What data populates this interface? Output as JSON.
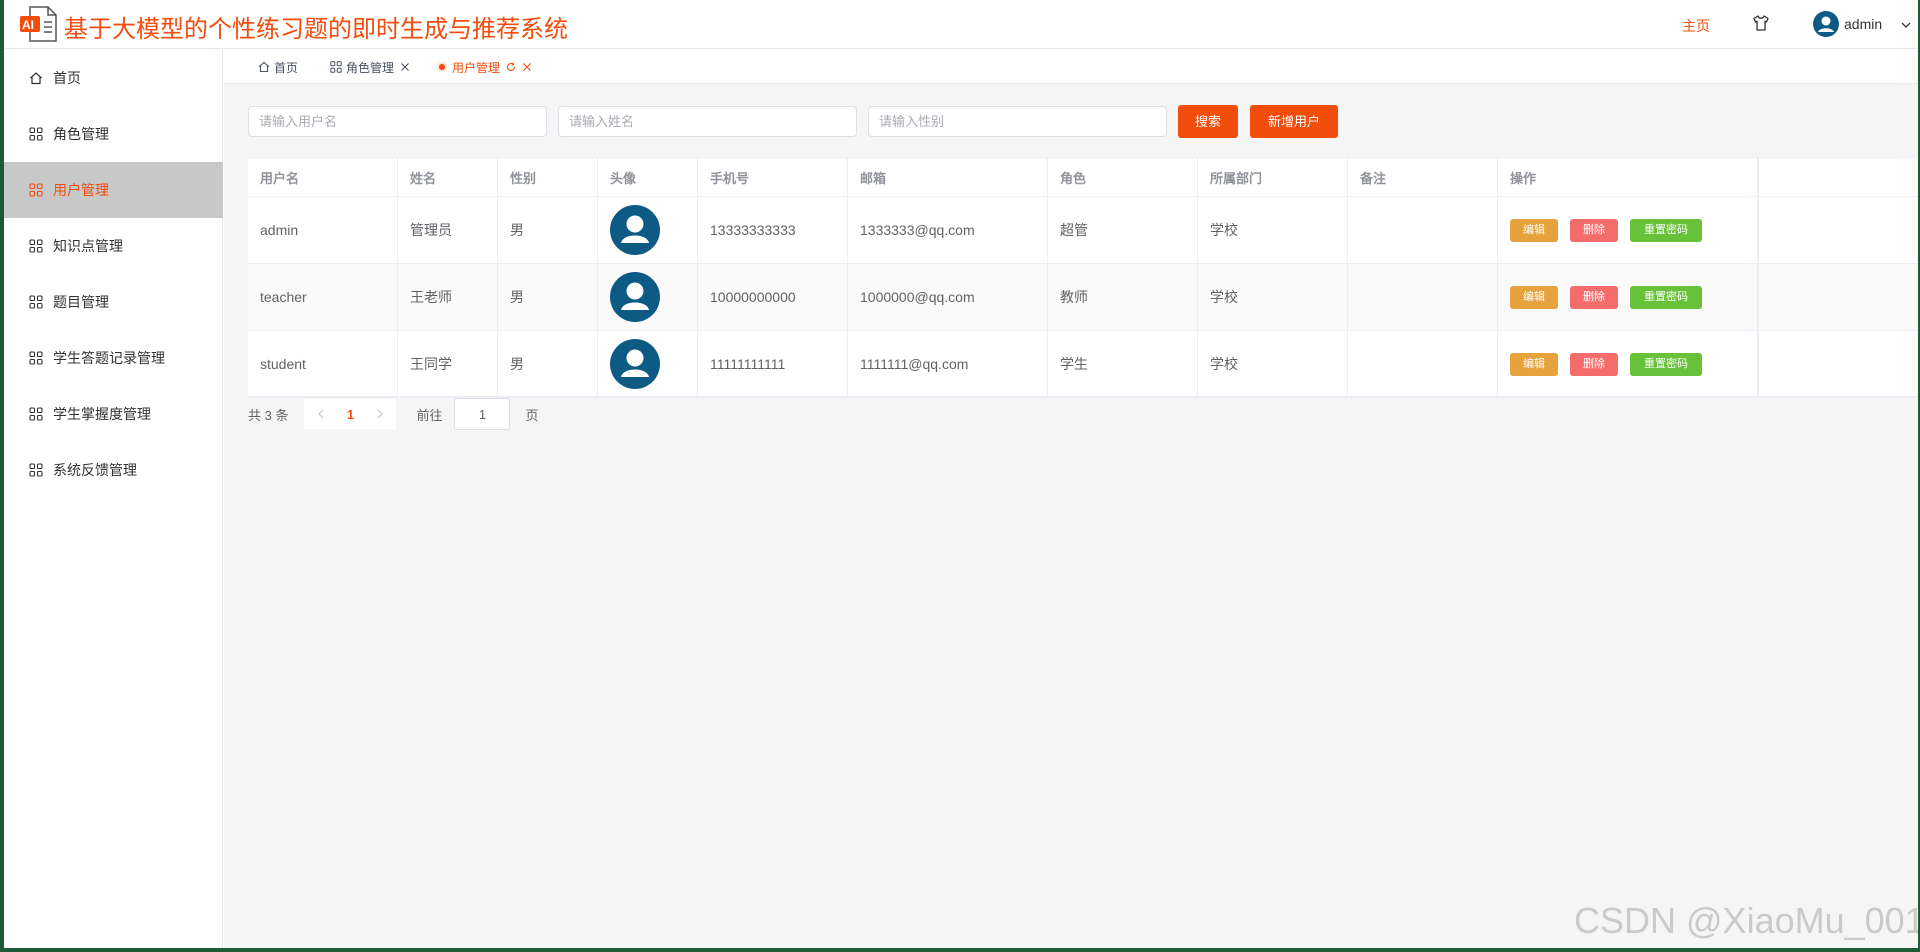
{
  "app": {
    "title": "基于大模型的个性练习题的即时生成与推荐系统"
  },
  "header": {
    "home_label": "主页",
    "user_name": "admin"
  },
  "sidebar": {
    "items": [
      {
        "label": "首页",
        "icon": "home-icon",
        "active": false
      },
      {
        "label": "角色管理",
        "icon": "grid-icon",
        "active": false
      },
      {
        "label": "用户管理",
        "icon": "grid-icon",
        "active": true
      },
      {
        "label": "知识点管理",
        "icon": "grid-icon",
        "active": false
      },
      {
        "label": "题目管理",
        "icon": "grid-icon",
        "active": false
      },
      {
        "label": "学生答题记录管理",
        "icon": "grid-icon",
        "active": false
      },
      {
        "label": "学生掌握度管理",
        "icon": "grid-icon",
        "active": false
      },
      {
        "label": "系统反馈管理",
        "icon": "grid-icon",
        "active": false
      }
    ]
  },
  "tabs": [
    {
      "label": "首页"
    },
    {
      "label": "角色管理"
    },
    {
      "label": "用户管理"
    }
  ],
  "search": {
    "username_placeholder": "请输入用户名",
    "name_placeholder": "请输入姓名",
    "gender_placeholder": "请输入性别",
    "search_label": "搜索",
    "add_label": "新增用户"
  },
  "table": {
    "headers": [
      "用户名",
      "姓名",
      "性别",
      "头像",
      "手机号",
      "邮箱",
      "角色",
      "所属部门",
      "备注",
      "操作"
    ],
    "rows": [
      {
        "username": "admin",
        "name": "管理员",
        "gender": "男",
        "phone": "13333333333",
        "email": "1333333@qq.com",
        "role": "超管",
        "dept": "学校",
        "remark": ""
      },
      {
        "username": "teacher",
        "name": "王老师",
        "gender": "男",
        "phone": "10000000000",
        "email": "1000000@qq.com",
        "role": "教师",
        "dept": "学校",
        "remark": ""
      },
      {
        "username": "student",
        "name": "王同学",
        "gender": "男",
        "phone": "11111111111",
        "email": "1111111@qq.com",
        "role": "学生",
        "dept": "学校",
        "remark": ""
      }
    ],
    "actions": {
      "edit": "编辑",
      "delete": "删除",
      "reset": "重置密码"
    }
  },
  "pagination": {
    "total_text": "共 3 条",
    "current_page": "1",
    "goto_label": "前往",
    "goto_value": "1",
    "page_suffix": "页"
  },
  "watermark": "CSDN @XiaoMu_001",
  "colors": {
    "accent": "#f24d0c",
    "edit": "#e6a23c",
    "delete": "#f56c6c",
    "reset": "#67c23a",
    "avatar": "#0d5a85",
    "frame": "#1e5a38"
  }
}
